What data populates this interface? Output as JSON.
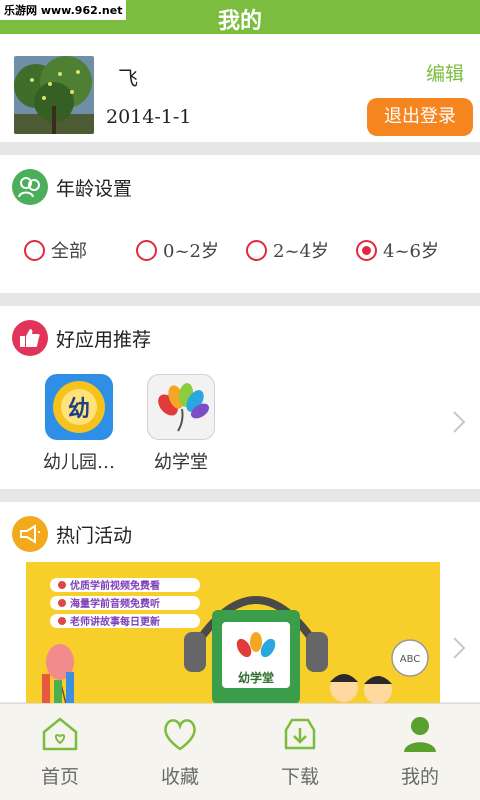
{
  "watermark": "乐游网 www.962.net",
  "header": {
    "title": "我的"
  },
  "profile": {
    "username": "飞",
    "birthday": "2014-1-1",
    "edit_label": "编辑",
    "logout_label": "退出登录"
  },
  "age_settings": {
    "title": "年龄设置",
    "options": [
      {
        "label": "全部",
        "checked": false
      },
      {
        "label": "0~2岁",
        "checked": false
      },
      {
        "label": "2~4岁",
        "checked": false
      },
      {
        "label": "4~6岁",
        "checked": true
      }
    ]
  },
  "recommended_apps": {
    "title": "好应用推荐",
    "apps": [
      {
        "name": "幼儿园…",
        "icon": "you-badge-icon"
      },
      {
        "name": "幼学堂",
        "icon": "peacock-feather-icon"
      }
    ]
  },
  "hot_events": {
    "title": "热门活动",
    "banner_lines": [
      "优质学前视频免费看",
      "海量学前音频免费听",
      "老师讲故事每日更新"
    ],
    "banner_brand": "幼学堂",
    "banner_tag": "ABC"
  },
  "tabbar": {
    "tabs": [
      {
        "label": "首页",
        "icon": "home-icon",
        "active": false
      },
      {
        "label": "收藏",
        "icon": "heart-icon",
        "active": false
      },
      {
        "label": "下载",
        "icon": "download-icon",
        "active": false
      },
      {
        "label": "我的",
        "icon": "user-icon",
        "active": true
      }
    ]
  },
  "colors": {
    "brand_green": "#7bbd3f",
    "accent_orange": "#f5861f",
    "radio_red": "#e0293e"
  }
}
